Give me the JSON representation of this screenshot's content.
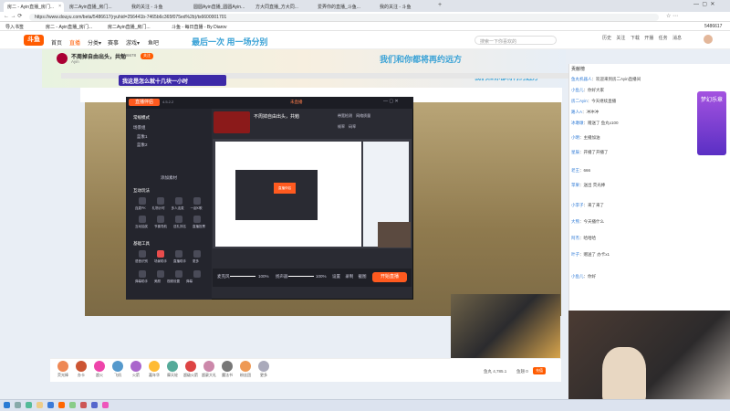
{
  "browser": {
    "tabs": [
      {
        "label": "房二 - Ayin直播_房门..."
      },
      {
        "label": "房二Ayin直播_房门..."
      },
      {
        "label": "我的关注 - 斗鱼"
      },
      {
        "label": "圆圆Ayin直播_圆圆Ayin..."
      },
      {
        "label": "方大同直播_方大同..."
      },
      {
        "label": "爱弄你的直播_斗鱼..."
      },
      {
        "label": "我的关注 - 斗鱼"
      }
    ],
    "url": "https://www.douyu.com/beta/5486617(ryuhid=256441b-7465b6c365f075ed%2b)/ts6600001701",
    "bookmarks": [
      "导入书签",
      "房二 - Ayin直播_房门...",
      "房二Ayin直播_房门...",
      "斗鱼 - 每日直播 - By Diarov"
    ]
  },
  "site": {
    "logo": "斗鱼",
    "nav": [
      "首页",
      "直播",
      "分类▾",
      "赛事",
      "游戏▾",
      "鱼吧"
    ],
    "search_placeholder": "搜索一下你喜欢的",
    "user_icons": [
      "历史",
      "关注",
      "下载",
      "开播",
      "任务",
      "消息"
    ],
    "user_id": "5486617",
    "banner_slogans": [
      "最后一次 用一场分别",
      "我们和你都将再约远方",
      "我们和你都将再约远方"
    ]
  },
  "stream": {
    "title": "不周掉自由出头，共勉",
    "host_tag": "Ayin",
    "overlay_text": "我这是怎么就十几块一小时",
    "follow": "关注",
    "counter": "546678"
  },
  "obs": {
    "app_title": "直播伴侣",
    "version": "4.5.2.2",
    "live_label": "未直播",
    "mode_label": "常规模式",
    "scene_label": "场景组",
    "scenes": [
      "蓝象1",
      "蓝象2"
    ],
    "add_scene": "添加素材",
    "sections": [
      "互动玩法",
      "基础工具"
    ],
    "tools_row1": [
      "连麦PK",
      "礼物计时",
      "多人连麦",
      "一起K歌"
    ],
    "tools_row2": [
      "互动抽奖",
      "节奏导航",
      "送礼排名",
      "直播投票"
    ],
    "tools_row3": [
      "语音识别",
      "场景助手",
      "直播助手",
      "更多"
    ],
    "tools_row4": [
      "弹幕助手",
      "美颜",
      "视频设置",
      "弹幕"
    ],
    "header_stats": [
      "带宽检测",
      "网络质量",
      "帧率",
      "码率"
    ],
    "mic_label": "麦克风",
    "mic_value": "100%",
    "speaker_label": "扬声器",
    "speaker_value": "100%",
    "bottom_icons": [
      "设置",
      "录制",
      "截图"
    ],
    "start_button": "开始直播",
    "preview_window_title": "直播伴侣"
  },
  "gifts": [
    {
      "name": "荧光棒"
    },
    {
      "name": "办卡"
    },
    {
      "name": "超火"
    },
    {
      "name": "飞机"
    },
    {
      "name": "火箭"
    },
    {
      "name": "嘉年华"
    },
    {
      "name": "摩天轮"
    },
    {
      "name": "超级火箭"
    },
    {
      "name": "超豪大礼"
    },
    {
      "name": "魔法书"
    },
    {
      "name": "粉丝团"
    },
    {
      "name": "更多"
    }
  ],
  "gift_stats": {
    "yuchi": "鱼丸 4,785.1",
    "fish": "鱼翅 0",
    "recharge": "充值"
  },
  "chat": [
    {
      "user": "鱼丸机器人",
      "text": "欢迎来到房二Ayin直播间"
    },
    {
      "user": "小鱼儿",
      "text": "你好大家"
    },
    {
      "user": "房二Ayin",
      "text": "今天继续直播"
    },
    {
      "user": "路人A",
      "text": "冲冲冲"
    },
    {
      "user": "冰墩墩",
      "text": "赠送了 鱼丸x100"
    },
    {
      "user": "小明",
      "text": "主播加油"
    },
    {
      "user": "星辰",
      "text": "开播了开播了"
    },
    {
      "user": "老王",
      "text": "666"
    },
    {
      "user": "苹果",
      "text": "送出 荧光棒"
    },
    {
      "user": "小李子",
      "text": "来了来了"
    },
    {
      "user": "大熊",
      "text": "今天播什么"
    },
    {
      "user": "阿杰",
      "text": "哈哈哈"
    },
    {
      "user": "叶子",
      "text": "赠送了 办卡x1"
    },
    {
      "user": "小鱼儿",
      "text": "你好"
    }
  ],
  "sidebar_ranking_title": "贡献榜",
  "sidebar_event": "梦幻乐章"
}
